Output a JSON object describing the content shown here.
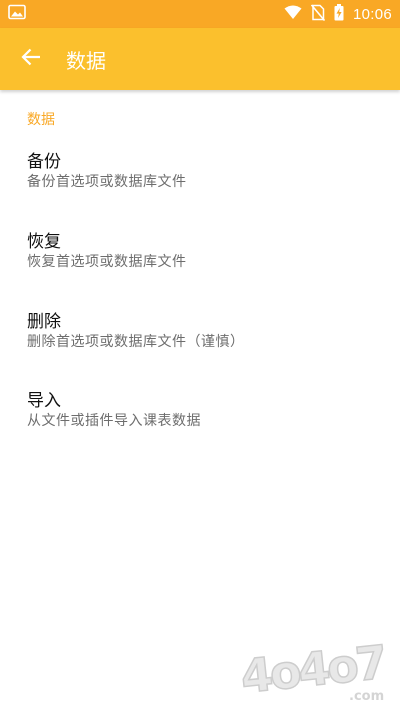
{
  "status_bar": {
    "time": "10:06",
    "icons": [
      "image-icon",
      "wifi-icon",
      "no-sim-icon",
      "battery-charging-icon"
    ]
  },
  "app_bar": {
    "title": "数据",
    "back_icon": "arrow-left-icon"
  },
  "section": {
    "header": "数据"
  },
  "items": [
    {
      "title": "备份",
      "summary": "备份首选项或数据库文件"
    },
    {
      "title": "恢复",
      "summary": "恢复首选项或数据库文件"
    },
    {
      "title": "删除",
      "summary": "删除首选项或数据库文件（谨慎）"
    },
    {
      "title": "导入",
      "summary": "从文件或插件导入课表数据"
    }
  ],
  "watermark": {
    "text": "4o4o7",
    "suffix": ".com"
  },
  "colors": {
    "status_bar": "#F9A825",
    "app_bar": "#FBC02D",
    "accent": "#F9A825",
    "title_text": "#111111",
    "summary_text": "#6d6d6d"
  }
}
